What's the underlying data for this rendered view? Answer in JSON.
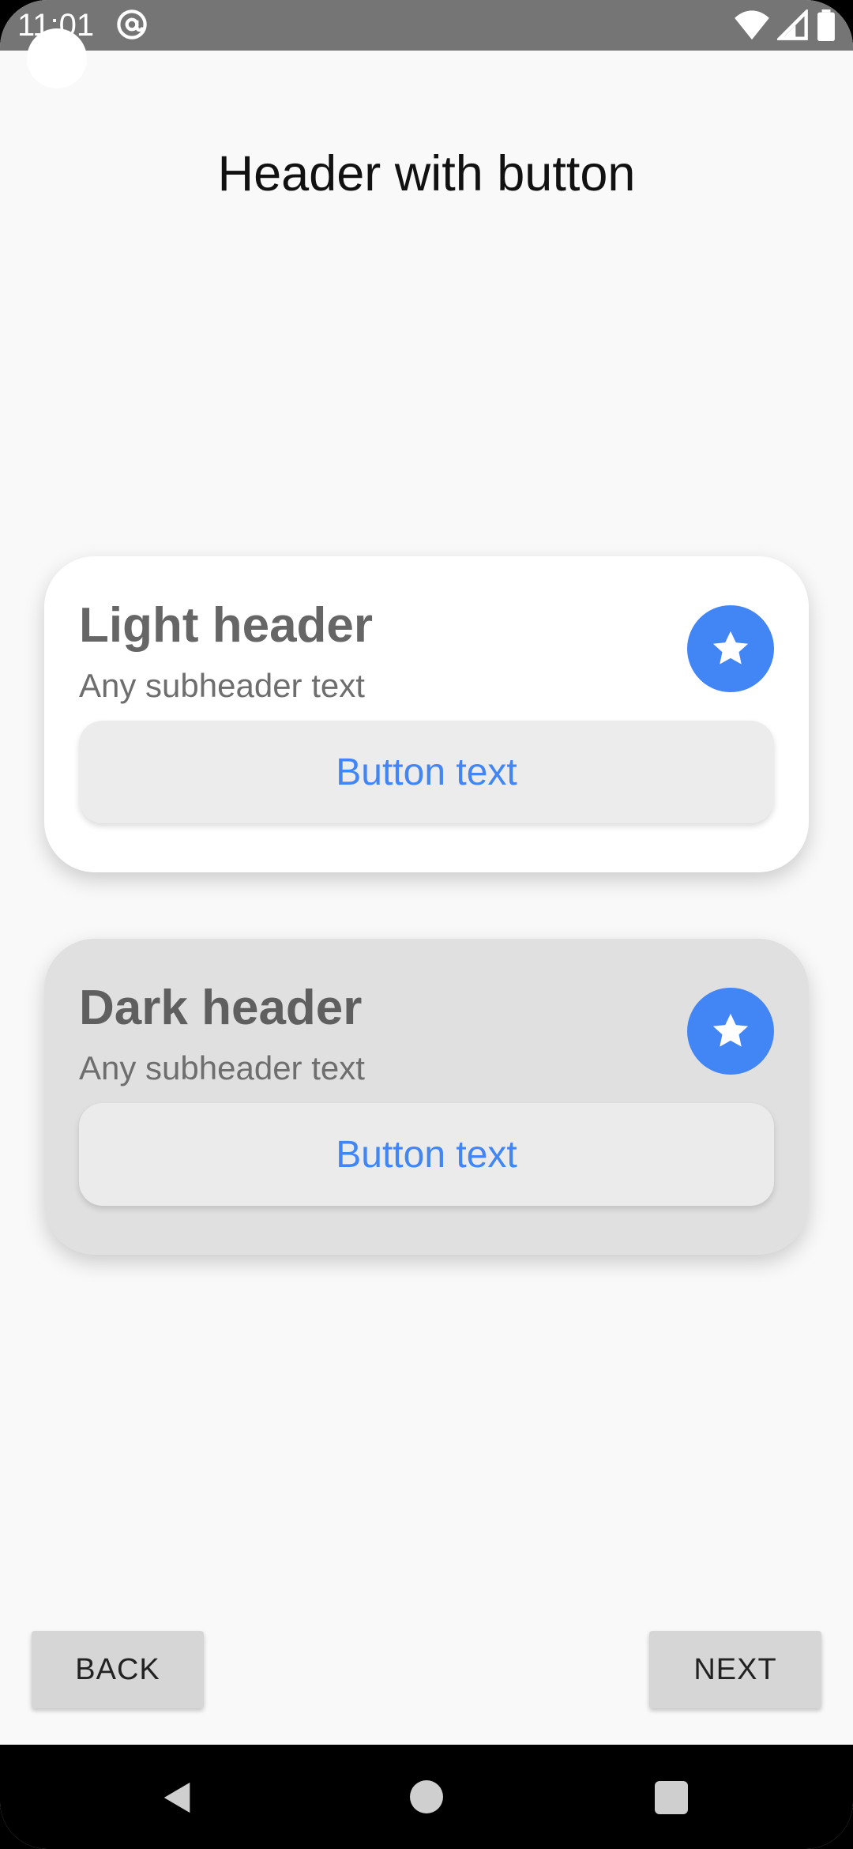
{
  "status_bar": {
    "time": "11:01",
    "icons": [
      "at-sign-icon",
      "wifi-icon",
      "signal-icon",
      "battery-icon"
    ]
  },
  "page": {
    "title": "Header with button"
  },
  "cards": [
    {
      "variant": "light",
      "title": "Light header",
      "subtitle": "Any subheader text",
      "button_label": "Button text",
      "icon": "star-icon"
    },
    {
      "variant": "dark",
      "title": "Dark header",
      "subtitle": "Any subheader text",
      "button_label": "Button text",
      "icon": "star-icon"
    }
  ],
  "navigation": {
    "back_label": "BACK",
    "next_label": "NEXT"
  },
  "colors": {
    "accent": "#4285f4",
    "status_bar": "#757575",
    "dark_card": "#e0e0e0",
    "light_card": "#ffffff"
  }
}
